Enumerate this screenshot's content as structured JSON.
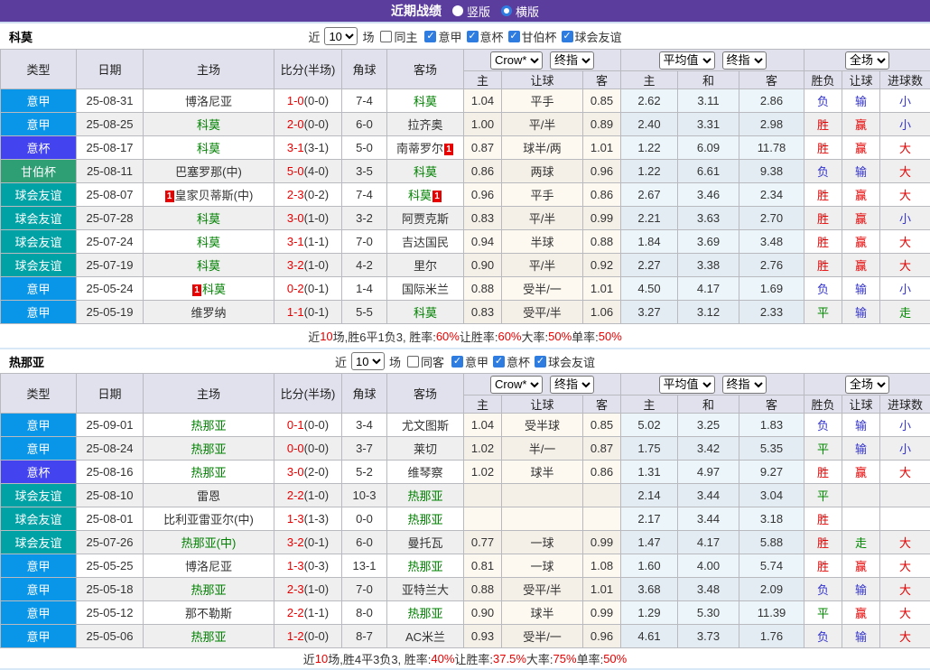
{
  "topbar": {
    "title": "近期战绩",
    "radios": [
      {
        "label": "竖版",
        "checked": false
      },
      {
        "label": "横版",
        "checked": true
      }
    ]
  },
  "columns": {
    "left": [
      "类型",
      "日期",
      "主场",
      "比分(半场)",
      "角球",
      "客场"
    ],
    "sub": [
      "主",
      "让球",
      "客",
      "主",
      "和",
      "客",
      "胜负",
      "让球",
      "进球数"
    ]
  },
  "selects": {
    "market": "Crow*",
    "final1": "终指",
    "avg": "平均值",
    "final2": "终指",
    "scope": "全场"
  },
  "type_colors": {
    "意甲": "#0a96e8",
    "意杯": "#4343f0",
    "甘伯杯": "#2e9e75",
    "球会友谊": "#00a2a6"
  },
  "colors": {
    "topbar_purple": "#5b3d9d",
    "win_red": "#e60000",
    "lose_blue": "#3434cc",
    "draw_green": "#008800",
    "focal_team_green": "#008000"
  },
  "tables": [
    {
      "team": "科莫",
      "controls": {
        "near_label": "近",
        "games": "10",
        "games_label": "场",
        "same_label": "同主",
        "same_checked": false,
        "leagues": [
          {
            "label": "意甲",
            "checked": true
          },
          {
            "label": "意杯",
            "checked": true
          },
          {
            "label": "甘伯杯",
            "checked": true
          },
          {
            "label": "球会友谊",
            "checked": true
          }
        ]
      },
      "rows": [
        {
          "type": "意甲",
          "date": "25-08-31",
          "home": {
            "name": "博洛尼亚"
          },
          "score_ft": "1-0",
          "score_ht": "(0-0)",
          "corner": "7-4",
          "away": {
            "name": "科莫",
            "focal": true
          },
          "crow": [
            "1.04",
            "平手",
            "0.85"
          ],
          "avg": [
            "2.62",
            "3.11",
            "2.86"
          ],
          "result": [
            [
              "负",
              "b"
            ],
            [
              "输",
              "b"
            ],
            [
              "小",
              "b"
            ]
          ]
        },
        {
          "type": "意甲",
          "date": "25-08-25",
          "home": {
            "name": "科莫",
            "focal": true
          },
          "score_ft": "2-0",
          "score_ht": "(0-0)",
          "corner": "6-0",
          "away": {
            "name": "拉齐奥"
          },
          "crow": [
            "1.00",
            "平/半",
            "0.89"
          ],
          "avg": [
            "2.40",
            "3.31",
            "2.98"
          ],
          "result": [
            [
              "胜",
              "r"
            ],
            [
              "赢",
              "r"
            ],
            [
              "小",
              "b"
            ]
          ]
        },
        {
          "type": "意杯",
          "date": "25-08-17",
          "home": {
            "name": "科莫",
            "focal": true
          },
          "score_ft": "3-1",
          "score_ht": "(3-1)",
          "corner": "5-0",
          "away": {
            "name": "南蒂罗尔",
            "red_after": true
          },
          "crow": [
            "0.87",
            "球半/两",
            "1.01"
          ],
          "avg": [
            "1.22",
            "6.09",
            "11.78"
          ],
          "result": [
            [
              "胜",
              "r"
            ],
            [
              "赢",
              "r"
            ],
            [
              "大",
              "r"
            ]
          ]
        },
        {
          "type": "甘伯杯",
          "date": "25-08-11",
          "home": {
            "name": "巴塞罗那(中)"
          },
          "score_ft": "5-0",
          "score_ht": "(4-0)",
          "corner": "3-5",
          "away": {
            "name": "科莫",
            "focal": true
          },
          "crow": [
            "0.86",
            "两球",
            "0.96"
          ],
          "avg": [
            "1.22",
            "6.61",
            "9.38"
          ],
          "result": [
            [
              "负",
              "b"
            ],
            [
              "输",
              "b"
            ],
            [
              "大",
              "r"
            ]
          ]
        },
        {
          "type": "球会友谊",
          "date": "25-08-07",
          "home": {
            "name": "皇家贝蒂斯(中)",
            "red_before": true
          },
          "score_ft": "2-3",
          "score_ht": "(0-2)",
          "corner": "7-4",
          "away": {
            "name": "科莫",
            "focal": true,
            "red_after": true
          },
          "crow": [
            "0.96",
            "平手",
            "0.86"
          ],
          "avg": [
            "2.67",
            "3.46",
            "2.34"
          ],
          "result": [
            [
              "胜",
              "r"
            ],
            [
              "赢",
              "r"
            ],
            [
              "大",
              "r"
            ]
          ]
        },
        {
          "type": "球会友谊",
          "date": "25-07-28",
          "home": {
            "name": "科莫",
            "focal": true
          },
          "score_ft": "3-0",
          "score_ht": "(1-0)",
          "corner": "3-2",
          "away": {
            "name": "阿贾克斯"
          },
          "crow": [
            "0.83",
            "平/半",
            "0.99"
          ],
          "avg": [
            "2.21",
            "3.63",
            "2.70"
          ],
          "result": [
            [
              "胜",
              "r"
            ],
            [
              "赢",
              "r"
            ],
            [
              "小",
              "b"
            ]
          ]
        },
        {
          "type": "球会友谊",
          "date": "25-07-24",
          "home": {
            "name": "科莫",
            "focal": true
          },
          "score_ft": "3-1",
          "score_ht": "(1-1)",
          "corner": "7-0",
          "away": {
            "name": "吉达国民"
          },
          "crow": [
            "0.94",
            "半球",
            "0.88"
          ],
          "avg": [
            "1.84",
            "3.69",
            "3.48"
          ],
          "result": [
            [
              "胜",
              "r"
            ],
            [
              "赢",
              "r"
            ],
            [
              "大",
              "r"
            ]
          ]
        },
        {
          "type": "球会友谊",
          "date": "25-07-19",
          "home": {
            "name": "科莫",
            "focal": true
          },
          "score_ft": "3-2",
          "score_ht": "(1-0)",
          "corner": "4-2",
          "away": {
            "name": "里尔"
          },
          "crow": [
            "0.90",
            "平/半",
            "0.92"
          ],
          "avg": [
            "2.27",
            "3.38",
            "2.76"
          ],
          "result": [
            [
              "胜",
              "r"
            ],
            [
              "赢",
              "r"
            ],
            [
              "大",
              "r"
            ]
          ]
        },
        {
          "type": "意甲",
          "date": "25-05-24",
          "home": {
            "name": "科莫",
            "focal": true,
            "red_before": true
          },
          "score_ft": "0-2",
          "score_ht": "(0-1)",
          "corner": "1-4",
          "away": {
            "name": "国际米兰"
          },
          "crow": [
            "0.88",
            "受半/一",
            "1.01"
          ],
          "avg": [
            "4.50",
            "4.17",
            "1.69"
          ],
          "result": [
            [
              "负",
              "b"
            ],
            [
              "输",
              "b"
            ],
            [
              "小",
              "b"
            ]
          ]
        },
        {
          "type": "意甲",
          "date": "25-05-19",
          "home": {
            "name": "维罗纳"
          },
          "score_ft": "1-1",
          "score_ht": "(0-1)",
          "corner": "5-5",
          "away": {
            "name": "科莫",
            "focal": true
          },
          "crow": [
            "0.83",
            "受平/半",
            "1.06"
          ],
          "avg": [
            "3.27",
            "3.12",
            "2.33"
          ],
          "result": [
            [
              "平",
              "g"
            ],
            [
              "输",
              "b"
            ],
            [
              "走",
              "g"
            ]
          ]
        }
      ],
      "summary": [
        {
          "t": "近"
        },
        {
          "t": "10",
          "red": true
        },
        {
          "t": "场,胜6平1负3, 胜率:"
        },
        {
          "t": "60%",
          "red": true
        },
        {
          "t": " 让胜率:"
        },
        {
          "t": "60%",
          "red": true
        },
        {
          "t": " 大率:"
        },
        {
          "t": "50%",
          "red": true
        },
        {
          "t": " 单率:"
        },
        {
          "t": "50%",
          "red": true
        }
      ]
    },
    {
      "team": "热那亚",
      "controls": {
        "near_label": "近",
        "games": "10",
        "games_label": "场",
        "same_label": "同客",
        "same_checked": false,
        "leagues": [
          {
            "label": "意甲",
            "checked": true
          },
          {
            "label": "意杯",
            "checked": true
          },
          {
            "label": "球会友谊",
            "checked": true
          }
        ]
      },
      "rows": [
        {
          "type": "意甲",
          "date": "25-09-01",
          "home": {
            "name": "热那亚",
            "focal": true
          },
          "score_ft": "0-1",
          "score_ht": "(0-0)",
          "corner": "3-4",
          "away": {
            "name": "尤文图斯"
          },
          "crow": [
            "1.04",
            "受半球",
            "0.85"
          ],
          "avg": [
            "5.02",
            "3.25",
            "1.83"
          ],
          "result": [
            [
              "负",
              "b"
            ],
            [
              "输",
              "b"
            ],
            [
              "小",
              "b"
            ]
          ]
        },
        {
          "type": "意甲",
          "date": "25-08-24",
          "home": {
            "name": "热那亚",
            "focal": true
          },
          "score_ft": "0-0",
          "score_ht": "(0-0)",
          "corner": "3-7",
          "away": {
            "name": "莱切"
          },
          "crow": [
            "1.02",
            "半/一",
            "0.87"
          ],
          "avg": [
            "1.75",
            "3.42",
            "5.35"
          ],
          "result": [
            [
              "平",
              "g"
            ],
            [
              "输",
              "b"
            ],
            [
              "小",
              "b"
            ]
          ]
        },
        {
          "type": "意杯",
          "date": "25-08-16",
          "home": {
            "name": "热那亚",
            "focal": true
          },
          "score_ft": "3-0",
          "score_ht": "(2-0)",
          "corner": "5-2",
          "away": {
            "name": "维琴察"
          },
          "crow": [
            "1.02",
            "球半",
            "0.86"
          ],
          "avg": [
            "1.31",
            "4.97",
            "9.27"
          ],
          "result": [
            [
              "胜",
              "r"
            ],
            [
              "赢",
              "r"
            ],
            [
              "大",
              "r"
            ]
          ]
        },
        {
          "type": "球会友谊",
          "date": "25-08-10",
          "home": {
            "name": "雷恩"
          },
          "score_ft": "2-2",
          "score_ht": "(1-0)",
          "corner": "10-3",
          "away": {
            "name": "热那亚",
            "focal": true
          },
          "crow": [
            "",
            "",
            ""
          ],
          "avg": [
            "2.14",
            "3.44",
            "3.04"
          ],
          "result": [
            [
              "平",
              "g"
            ],
            [
              "",
              ""
            ],
            [
              "",
              ""
            ]
          ]
        },
        {
          "type": "球会友谊",
          "date": "25-08-01",
          "home": {
            "name": "比利亚雷亚尔(中)"
          },
          "score_ft": "1-3",
          "score_ht": "(1-3)",
          "corner": "0-0",
          "away": {
            "name": "热那亚",
            "focal": true
          },
          "crow": [
            "",
            "",
            ""
          ],
          "avg": [
            "2.17",
            "3.44",
            "3.18"
          ],
          "result": [
            [
              "胜",
              "r"
            ],
            [
              "",
              ""
            ],
            [
              "",
              ""
            ]
          ]
        },
        {
          "type": "球会友谊",
          "date": "25-07-26",
          "home": {
            "name": "热那亚(中)",
            "focal": true
          },
          "score_ft": "3-2",
          "score_ht": "(0-1)",
          "corner": "6-0",
          "away": {
            "name": "曼托瓦"
          },
          "crow": [
            "0.77",
            "一球",
            "0.99"
          ],
          "avg": [
            "1.47",
            "4.17",
            "5.88"
          ],
          "result": [
            [
              "胜",
              "r"
            ],
            [
              "走",
              "g"
            ],
            [
              "大",
              "r"
            ]
          ]
        },
        {
          "type": "意甲",
          "date": "25-05-25",
          "home": {
            "name": "博洛尼亚"
          },
          "score_ft": "1-3",
          "score_ht": "(0-3)",
          "corner": "13-1",
          "away": {
            "name": "热那亚",
            "focal": true
          },
          "crow": [
            "0.81",
            "一球",
            "1.08"
          ],
          "avg": [
            "1.60",
            "4.00",
            "5.74"
          ],
          "result": [
            [
              "胜",
              "r"
            ],
            [
              "赢",
              "r"
            ],
            [
              "大",
              "r"
            ]
          ]
        },
        {
          "type": "意甲",
          "date": "25-05-18",
          "home": {
            "name": "热那亚",
            "focal": true
          },
          "score_ft": "2-3",
          "score_ht": "(1-0)",
          "corner": "7-0",
          "away": {
            "name": "亚特兰大"
          },
          "crow": [
            "0.88",
            "受平/半",
            "1.01"
          ],
          "avg": [
            "3.68",
            "3.48",
            "2.09"
          ],
          "result": [
            [
              "负",
              "b"
            ],
            [
              "输",
              "b"
            ],
            [
              "大",
              "r"
            ]
          ]
        },
        {
          "type": "意甲",
          "date": "25-05-12",
          "home": {
            "name": "那不勒斯"
          },
          "score_ft": "2-2",
          "score_ht": "(1-1)",
          "corner": "8-0",
          "away": {
            "name": "热那亚",
            "focal": true
          },
          "crow": [
            "0.90",
            "球半",
            "0.99"
          ],
          "avg": [
            "1.29",
            "5.30",
            "11.39"
          ],
          "result": [
            [
              "平",
              "g"
            ],
            [
              "赢",
              "r"
            ],
            [
              "大",
              "r"
            ]
          ]
        },
        {
          "type": "意甲",
          "date": "25-05-06",
          "home": {
            "name": "热那亚",
            "focal": true
          },
          "score_ft": "1-2",
          "score_ht": "(0-0)",
          "corner": "8-7",
          "away": {
            "name": "AC米兰"
          },
          "crow": [
            "0.93",
            "受半/一",
            "0.96"
          ],
          "avg": [
            "4.61",
            "3.73",
            "1.76"
          ],
          "result": [
            [
              "负",
              "b"
            ],
            [
              "输",
              "b"
            ],
            [
              "大",
              "r"
            ]
          ]
        }
      ],
      "summary": [
        {
          "t": "近"
        },
        {
          "t": "10",
          "red": true
        },
        {
          "t": "场,胜4平3负3, 胜率:"
        },
        {
          "t": "40%",
          "red": true
        },
        {
          "t": " 让胜率:"
        },
        {
          "t": "37.5%",
          "red": true
        },
        {
          "t": " 大率:"
        },
        {
          "t": "75%",
          "red": true
        },
        {
          "t": " 单率:"
        },
        {
          "t": "50%",
          "red": true
        }
      ]
    }
  ]
}
